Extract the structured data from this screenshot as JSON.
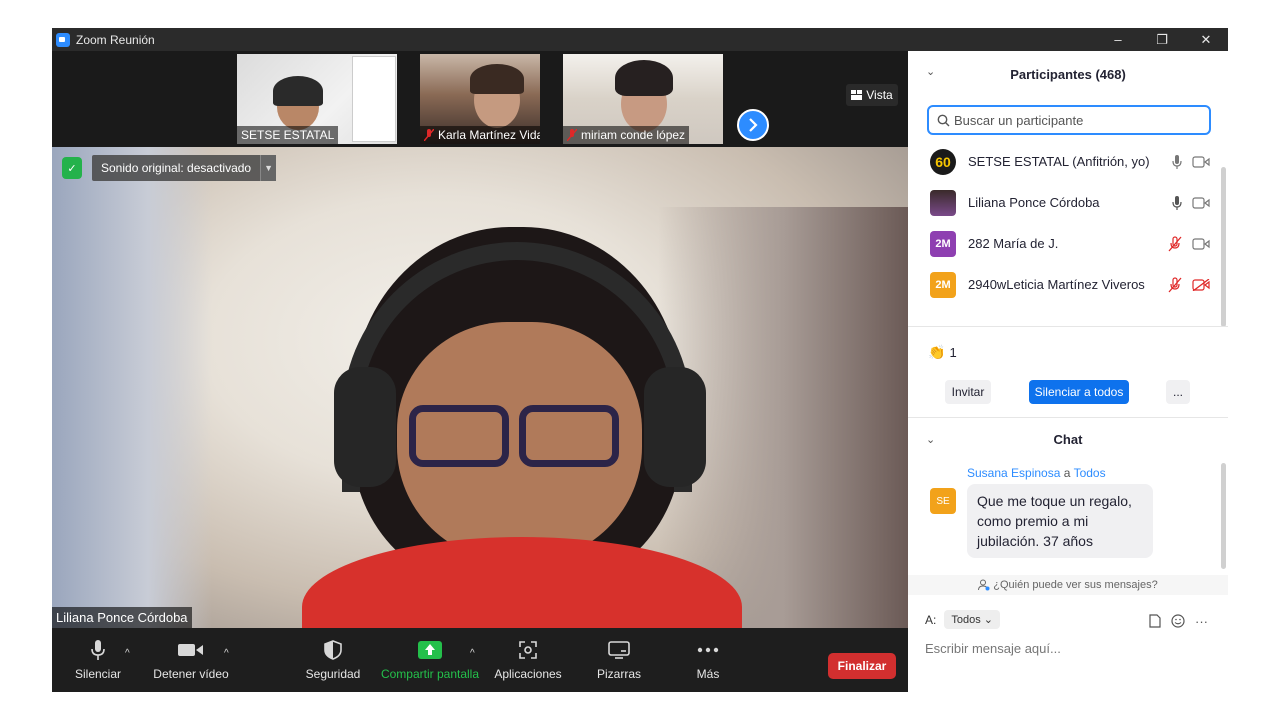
{
  "window": {
    "title": "Zoom Reunión",
    "minimize": "–",
    "restore": "❐",
    "close": "✕"
  },
  "thumbnails": [
    {
      "name": "SETSE ESTATAL"
    },
    {
      "name": "Karla Martínez Vidal"
    },
    {
      "name": "miriam conde lópez"
    }
  ],
  "view": {
    "label": "Vista"
  },
  "main": {
    "original_sound": "Sonido original: desactivado",
    "speaker_name": "Liliana Ponce Córdoba"
  },
  "toolbar": {
    "mute": "Silenciar",
    "stop_video": "Detener vídeo",
    "security": "Seguridad",
    "share": "Compartir pantalla",
    "apps": "Aplicaciones",
    "whiteboards": "Pizarras",
    "more": "Más",
    "end": "Finalizar"
  },
  "participants": {
    "title": "Participantes (468)",
    "search_placeholder": "Buscar un participante",
    "list": [
      {
        "avatar": "60",
        "name": "SETSE ESTATAL (Anfitrión, yo)",
        "avatar_color": "#1a1a1a"
      },
      {
        "avatar": "",
        "name": "Liliana Ponce Córdoba",
        "avatar_color": "#6b4a4a"
      },
      {
        "avatar": "2M",
        "name": "282 María de J.",
        "avatar_color": "#8e3fb1"
      },
      {
        "avatar": "2M",
        "name": "2940wLeticia Martínez Viveros",
        "avatar_color": "#f2a21a"
      }
    ],
    "reaction_count": "1",
    "invite": "Invitar",
    "mute_all": "Silenciar a todos",
    "more": "..."
  },
  "chat": {
    "title": "Chat",
    "sender": "Susana Espinosa",
    "to_word": "a",
    "recipient": "Todos",
    "sender_initials": "SE",
    "message": "Que me toque un regalo, como premio a mi jubilación. 37 años",
    "who_can_see": "¿Quién puede ver sus mensajes?",
    "to_label": "A:",
    "to_value": "Todos",
    "placeholder": "Escribir mensaje aquí...",
    "ellipsis": "···"
  }
}
